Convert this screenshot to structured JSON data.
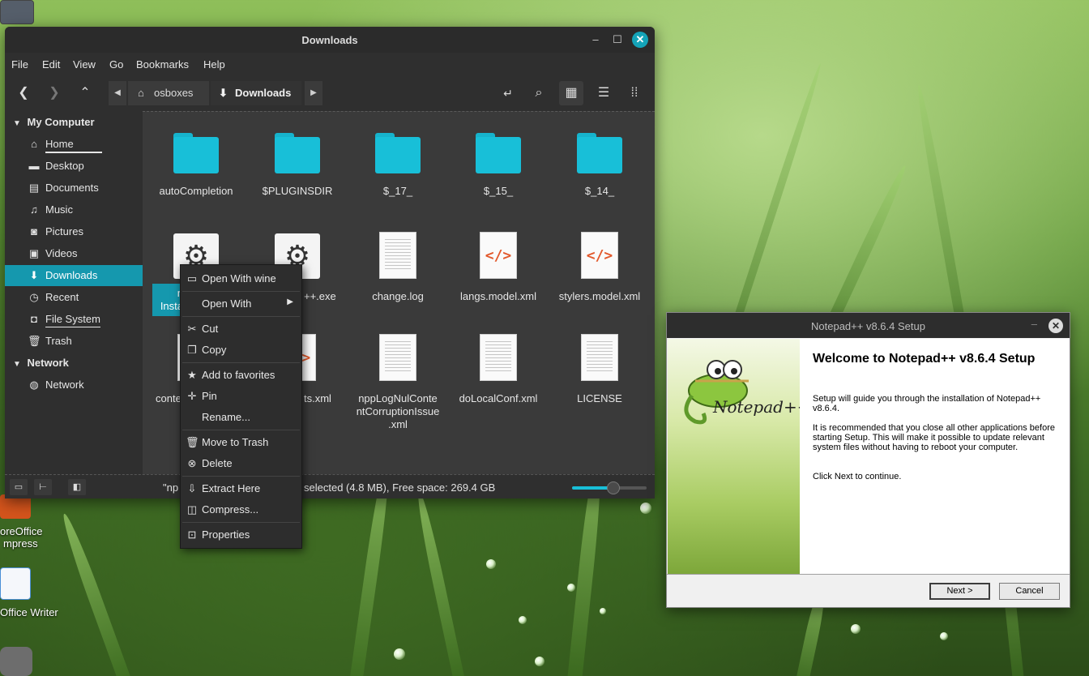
{
  "desktop": {
    "items": [
      {
        "label": "oreOffice"
      },
      {
        "label": "mpress"
      },
      {
        "label": "Office Writer"
      }
    ]
  },
  "nemo": {
    "title": "Downloads",
    "menu": [
      "File",
      "Edit",
      "View",
      "Go",
      "Bookmarks",
      "Help"
    ],
    "breadcrumbs": [
      {
        "label": "osboxes",
        "icon": "home-icon"
      },
      {
        "label": "Downloads",
        "icon": "download-icon"
      }
    ],
    "sidebar": {
      "section_computer": "My Computer",
      "computer_items": [
        {
          "label": "Home",
          "icon": "home-icon"
        },
        {
          "label": "Desktop",
          "icon": "desktop-icon"
        },
        {
          "label": "Documents",
          "icon": "documents-icon"
        },
        {
          "label": "Music",
          "icon": "music-icon"
        },
        {
          "label": "Pictures",
          "icon": "pictures-icon"
        },
        {
          "label": "Videos",
          "icon": "videos-icon"
        },
        {
          "label": "Downloads",
          "icon": "download-icon",
          "selected": true
        },
        {
          "label": "Recent",
          "icon": "recent-icon"
        },
        {
          "label": "File System",
          "icon": "drive-icon"
        },
        {
          "label": "Trash",
          "icon": "trash-icon"
        }
      ],
      "section_network": "Network",
      "network_items": [
        {
          "label": "Network",
          "icon": "network-icon"
        }
      ]
    },
    "files": [
      {
        "name": "autoCompletion",
        "type": "folder"
      },
      {
        "name": "$PLUGINSDIR",
        "type": "folder"
      },
      {
        "name": "$_17_",
        "type": "folder"
      },
      {
        "name": "$_15_",
        "type": "folder"
      },
      {
        "name": "$_14_",
        "type": "folder"
      },
      {
        "name": "n",
        "name2": "Insta",
        "type": "exe"
      },
      {
        "name": "++.exe",
        "type": "exe"
      },
      {
        "name": "change.log",
        "type": "text"
      },
      {
        "name": "langs.model.xml",
        "type": "xml"
      },
      {
        "name": "stylers.model.xml",
        "type": "xml"
      },
      {
        "name": "conte",
        "type": "text"
      },
      {
        "name": "ts.xml",
        "type": "xml"
      },
      {
        "name": "nppLogNulContentCorruptionIssue.xml",
        "line1": "nppLogNulConte",
        "line2": "ntCorruptionIssue",
        "line3": ".xml",
        "type": "text"
      },
      {
        "name": "doLocalConf.xml",
        "type": "text"
      },
      {
        "name": "LICENSE",
        "type": "text"
      }
    ],
    "status": {
      "left": "\"np",
      "right": "selected (4.8 MB), Free space: 269.4 GB",
      "zoom_fraction": 0.55
    }
  },
  "context_menu": {
    "items": [
      {
        "label": "Open With wine",
        "icon": "folder-icon"
      },
      {
        "label": "Open With",
        "submenu": true
      },
      {
        "label": "Cut",
        "icon": "scissors-icon"
      },
      {
        "label": "Copy",
        "icon": "copy-icon"
      },
      {
        "label": "Add to favorites",
        "icon": "star-icon"
      },
      {
        "label": "Pin",
        "icon": "pin-icon"
      },
      {
        "label": "Rename..."
      },
      {
        "label": "Move to Trash",
        "icon": "trash-icon"
      },
      {
        "label": "Delete",
        "icon": "delete-icon"
      },
      {
        "label": "Extract Here",
        "icon": "extract-icon"
      },
      {
        "label": "Compress...",
        "icon": "compress-icon"
      },
      {
        "label": "Properties",
        "icon": "properties-icon"
      }
    ]
  },
  "setup": {
    "title": "Notepad++ v8.6.4 Setup",
    "heading": "Welcome to Notepad++ v8.6.4 Setup",
    "p1": "Setup will guide you through the installation of Notepad++ v8.6.4.",
    "p2": "It is recommended that you close all other applications before starting Setup. This will make it possible to update relevant system files without having to reboot your computer.",
    "p3": "Click Next to continue.",
    "logo_text": "Notepad++",
    "next_label": "Next >",
    "cancel_label": "Cancel"
  },
  "colors": {
    "accent": "#1598ae",
    "folder": "#18bfd8",
    "window_bg": "#2f2f2f"
  }
}
